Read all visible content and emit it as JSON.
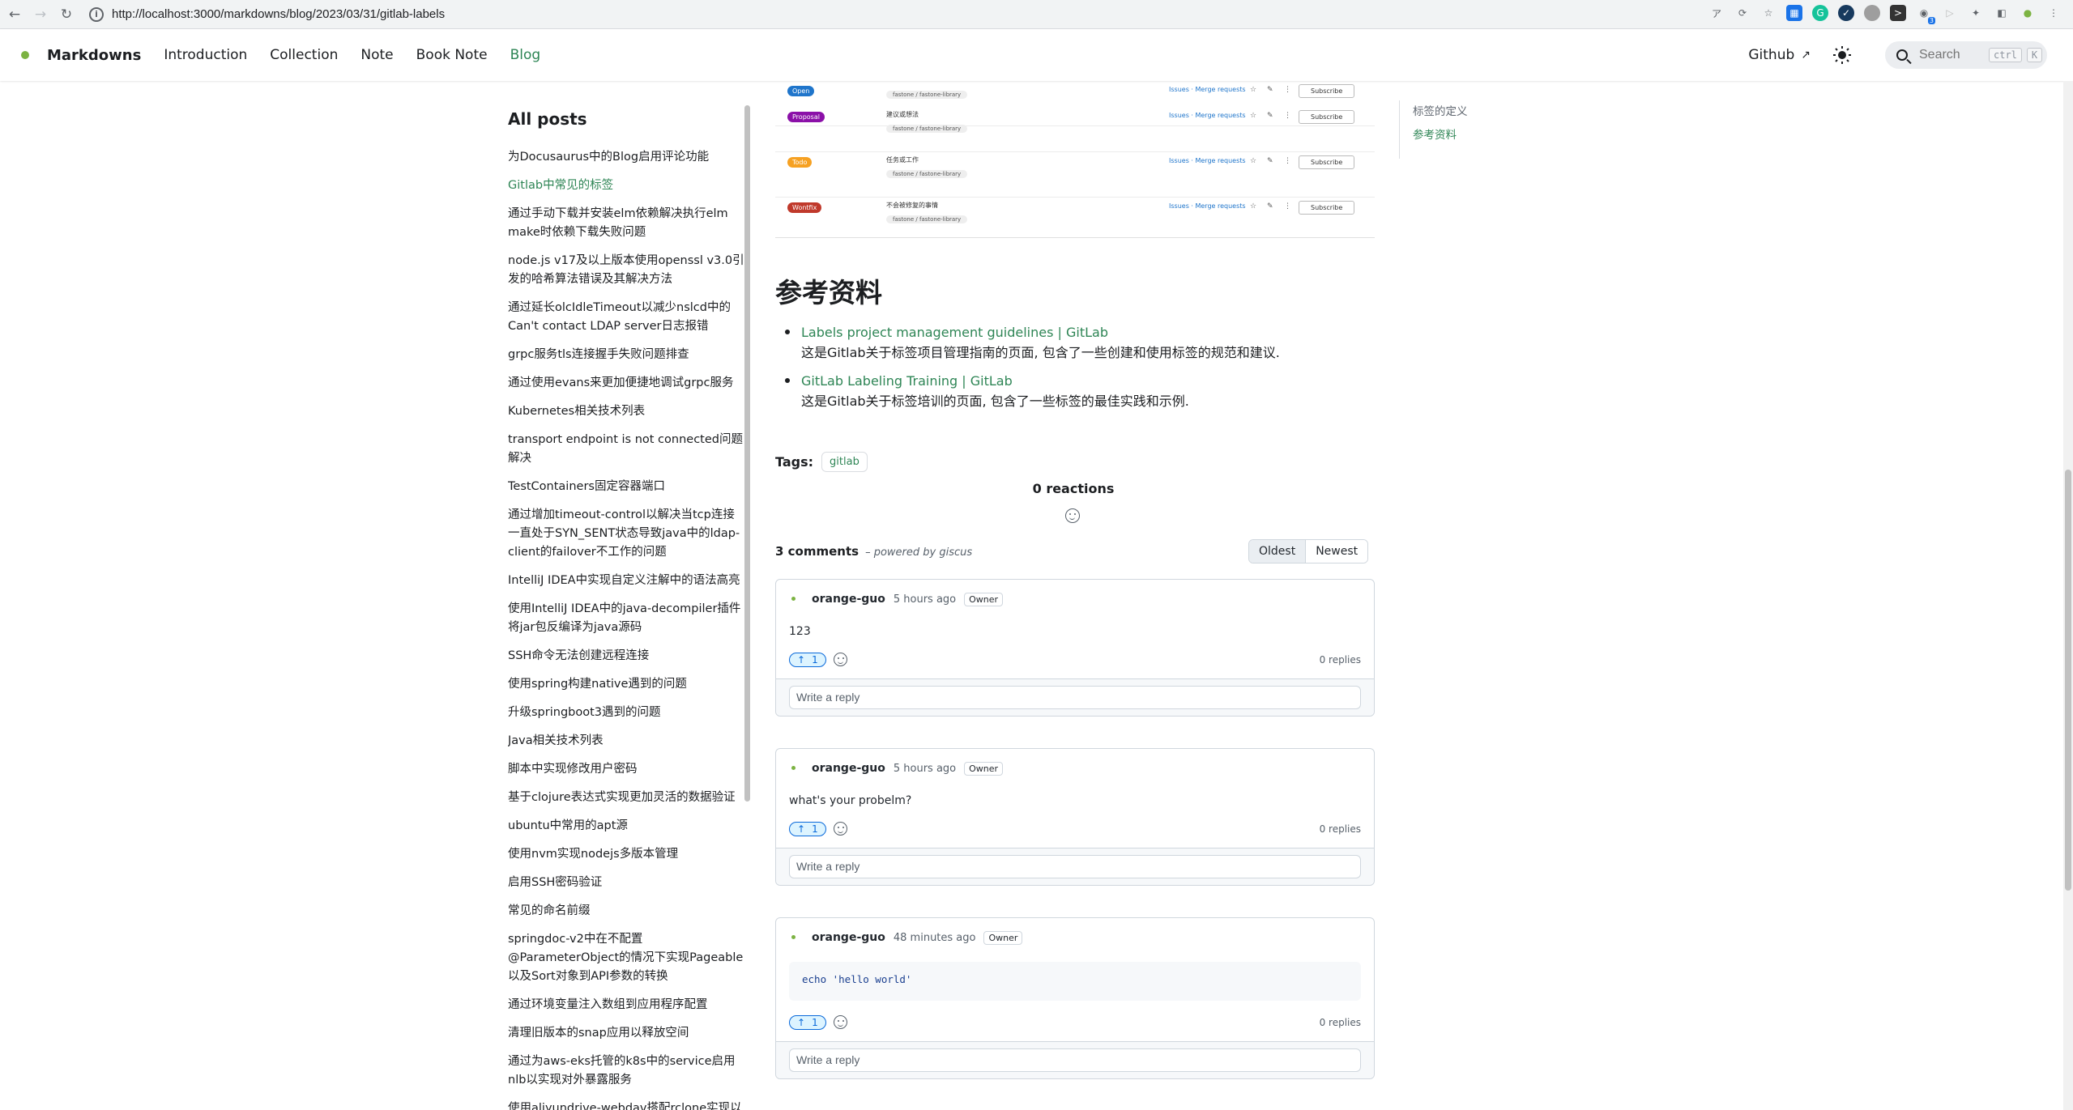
{
  "browser": {
    "url": "http://localhost:3000/markdowns/blog/2023/03/31/gitlab-labels",
    "extension_badge": "3"
  },
  "navbar": {
    "brand": "Markdowns",
    "links": [
      "Introduction",
      "Collection",
      "Note",
      "Book Note",
      "Blog"
    ],
    "active_link": "Blog",
    "github_label": "Github",
    "search_placeholder": "Search",
    "kbd_ctrl": "ctrl",
    "kbd_k": "K"
  },
  "sidebar": {
    "title": "All posts",
    "posts": [
      "为Docusaurus中的Blog启用评论功能",
      "Gitlab中常见的标签",
      "通过手动下载并安装elm依赖解决执行elm make时依赖下载失败问题",
      "node.js v17及以上版本使用openssl v3.0引发的哈希算法错误及其解决方法",
      "通过延长olcIdleTimeout以减少nslcd中的Can't contact LDAP server日志报错",
      "grpc服务tls连接握手失败问题排查",
      "通过使用evans来更加便捷地调试grpc服务",
      "Kubernetes相关技术列表",
      "transport endpoint is not connected问题解决",
      "TestContainers固定容器端口",
      "通过增加timeout-control以解决当tcp连接一直处于SYN_SENT状态导致java中的ldap-client的failover不工作的问题",
      "IntelliJ IDEA中实现自定义注解中的语法高亮",
      "使用IntelliJ IDEA中的java-decompiler插件将jar包反编译为java源码",
      "SSH命令无法创建远程连接",
      "使用spring构建native遇到的问题",
      "升级springboot3遇到的问题",
      "Java相关技术列表",
      "脚本中实现修改用户密码",
      "基于clojure表达式实现更加灵活的数据验证",
      "ubuntu中常用的apt源",
      "使用nvm实现nodejs多版本管理",
      "启用SSH密码验证",
      "常见的命名前缀",
      "springdoc-v2中在不配置@ParameterObject的情况下实现Pageable以及Sort对象到API参数的转换",
      "通过环境变量注入数组到应用程序配置",
      "清理旧版本的snap应用以释放空间",
      "通过为aws-eks托管的k8s中的service启用nlb以实现对外暴露服务",
      "使用aliyundrive-webdav搭配rclone实现以本"
    ],
    "active_index": 1
  },
  "screenshot_rows": [
    {
      "label": "Open",
      "color": "#1f75cb",
      "title": "",
      "chip": "fastone / fastone-library"
    },
    {
      "label": "Proposal",
      "color": "#8b10a8",
      "title": "建议或想法",
      "chip": "fastone / fastone-library"
    },
    {
      "label": "Todo",
      "color": "#f6a122",
      "title": "任务或工作",
      "chip": "fastone / fastone-library"
    },
    {
      "label": "Wontfix",
      "color": "#c0392b",
      "title": "不会被修复的事情",
      "chip": "fastone / fastone-library"
    }
  ],
  "screenshot_links": "Issues · Merge requests",
  "screenshot_subscribe": "Subscribe",
  "section_title": "参考资料",
  "references": [
    {
      "link": "Labels project management guidelines | GitLab",
      "desc": "这是Gitlab关于标签项目管理指南的页面, 包含了一些创建和使用标签的规范和建议."
    },
    {
      "link": "GitLab Labeling Training | GitLab",
      "desc": "这是Gitlab关于标签培训的页面, 包含了一些标签的最佳实践和示例."
    }
  ],
  "tags": {
    "label": "Tags:",
    "items": [
      "gitlab"
    ]
  },
  "reactions": {
    "count_label": "0 reactions"
  },
  "comments_header": {
    "count": "3 comments",
    "powered": "– powered by giscus",
    "sort_oldest": "Oldest",
    "sort_newest": "Newest"
  },
  "comments": [
    {
      "author": "orange-guo",
      "time": "5 hours ago",
      "badge": "Owner",
      "body": "123",
      "upvotes": "1",
      "replies": "0 replies",
      "reply_placeholder": "Write a reply"
    },
    {
      "author": "orange-guo",
      "time": "5 hours ago",
      "badge": "Owner",
      "body": "what's your probelm?",
      "upvotes": "1",
      "replies": "0 replies",
      "reply_placeholder": "Write a reply"
    },
    {
      "author": "orange-guo",
      "time": "48 minutes ago",
      "badge": "Owner",
      "code": "echo 'hello world'",
      "upvotes": "1",
      "replies": "0 replies",
      "reply_placeholder": "Write a reply"
    }
  ],
  "toc": {
    "items": [
      "标签的定义",
      "参考资料"
    ],
    "active_index": 1
  }
}
